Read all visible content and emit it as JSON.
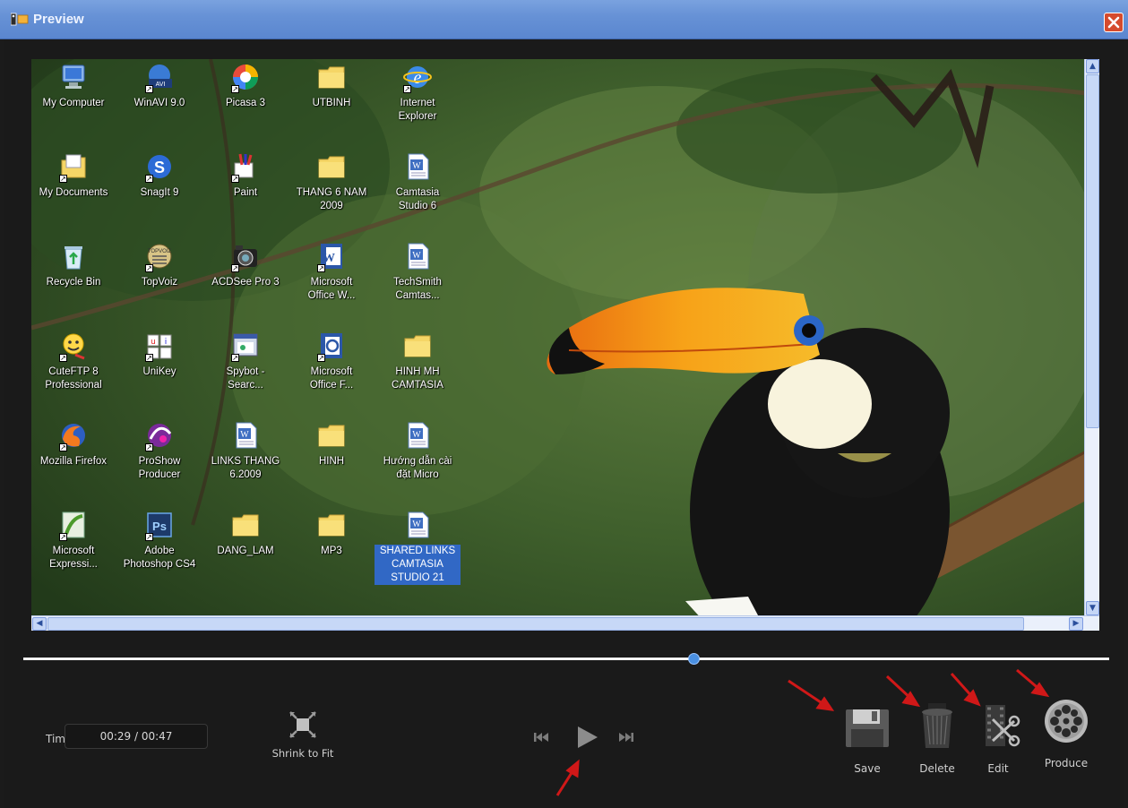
{
  "window": {
    "title": "Preview",
    "close_icon": "close-icon"
  },
  "desktop": {
    "icons": [
      {
        "label": "My Computer",
        "icon": "computer-icon"
      },
      {
        "label": "WinAVI 9.0",
        "icon": "winavi-icon"
      },
      {
        "label": "Picasa 3",
        "icon": "picasa-icon"
      },
      {
        "label": "UTBINH",
        "icon": "folder-icon"
      },
      {
        "label": "Internet\nExplorer",
        "icon": "ie-icon"
      },
      {
        "label": "My Documents",
        "icon": "documents-icon"
      },
      {
        "label": "SnagIt 9",
        "icon": "snagit-icon"
      },
      {
        "label": "Paint",
        "icon": "paint-icon"
      },
      {
        "label": "THANG 6 NAM\n2009",
        "icon": "folder-icon"
      },
      {
        "label": "Camtasia\nStudio 6",
        "icon": "word-doc-icon"
      },
      {
        "label": "Recycle Bin",
        "icon": "recycle-bin-icon"
      },
      {
        "label": "TopVoiz",
        "icon": "topvoiz-icon"
      },
      {
        "label": "ACDSee Pro 3",
        "icon": "acdsee-icon"
      },
      {
        "label": "Microsoft\nOffice W...",
        "icon": "word-icon"
      },
      {
        "label": "TechSmith\nCamtas...",
        "icon": "word-doc-icon"
      },
      {
        "label": "CuteFTP 8\nProfessional",
        "icon": "cuteftp-icon"
      },
      {
        "label": "UniKey",
        "icon": "unikey-icon"
      },
      {
        "label": "Spybot -\nSearc...",
        "icon": "spybot-icon"
      },
      {
        "label": "Microsoft\nOffice F...",
        "icon": "frontpage-icon"
      },
      {
        "label": "HINH MH\nCAMTASIA",
        "icon": "folder-icon"
      },
      {
        "label": "Mozilla Firefox",
        "icon": "firefox-icon"
      },
      {
        "label": "ProShow\nProducer",
        "icon": "proshow-icon"
      },
      {
        "label": "LINKS THANG\n6.2009",
        "icon": "word-doc-icon"
      },
      {
        "label": "HINH",
        "icon": "folder-icon"
      },
      {
        "label": "Hướng dẫn cài\nđặt Micro",
        "icon": "word-doc-icon"
      },
      {
        "label": "Microsoft\nExpressi...",
        "icon": "expression-icon"
      },
      {
        "label": "Adobe\nPhotoshop CS4",
        "icon": "photoshop-icon"
      },
      {
        "label": "DANG_LAM",
        "icon": "folder-icon"
      },
      {
        "label": "MP3",
        "icon": "folder-icon"
      },
      {
        "label": "SHARED LINKS\nCAMTASIA\nSTUDIO 21",
        "icon": "word-doc-icon"
      }
    ]
  },
  "playback": {
    "time_label": "Time",
    "current": "00:29",
    "sep": " / ",
    "total": "00:47",
    "progress": 0.617,
    "shrink_label": "Shrink to Fit"
  },
  "tools": {
    "save": "Save",
    "delete": "Delete",
    "edit": "Edit",
    "produce": "Produce"
  },
  "colors": {
    "titlebar": "#6792d6",
    "accent": "#4a90e2",
    "arrow": "#d01818",
    "background": "#1a1a1a"
  }
}
